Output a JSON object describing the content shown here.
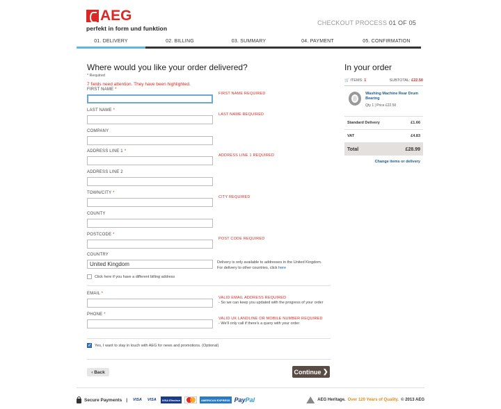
{
  "header": {
    "brand": "AEG",
    "tagline": "perfekt in form und funktion",
    "process_label": "CHECKOUT PROCESS",
    "process_current": "01 OF 05"
  },
  "steps": [
    {
      "label": "01. DELIVERY",
      "active": true
    },
    {
      "label": "02. BILLING",
      "active": false
    },
    {
      "label": "03. SUMMARY",
      "active": false
    },
    {
      "label": "04. PAYMENT",
      "active": false
    },
    {
      "label": "05. CONFIRMATION",
      "active": false
    }
  ],
  "form": {
    "title": "Where would you like your order delivered?",
    "required_note": "Required",
    "error_summary": "7 fields need attention. They have been highlighted.",
    "first_name": {
      "label": "FIRST NAME",
      "value": "",
      "error": "FIRST NAME REQUIRED"
    },
    "last_name": {
      "label": "LAST NAME",
      "value": "",
      "error": "LAST NAME REQUIRED"
    },
    "company": {
      "label": "COMPANY",
      "value": ""
    },
    "address1": {
      "label": "ADDRESS LINE 1",
      "value": "",
      "error": "ADDRESS LINE 1 REQUIRED"
    },
    "address2": {
      "label": "ADDRESS LINE 2",
      "value": ""
    },
    "town": {
      "label": "TOWN/CITY",
      "value": "",
      "error": "CITY REQUIRED"
    },
    "county": {
      "label": "COUNTY",
      "value": ""
    },
    "postcode": {
      "label": "POSTCODE",
      "value": "",
      "error": "POST CODE REQUIRED"
    },
    "country": {
      "label": "COUNTRY",
      "value": "United Kingdom",
      "note_1": "Delivery is only available to addresses in the United Kingdom.",
      "note_2": "For delivery to other countries, click ",
      "note_link": "here"
    },
    "billing_check": "Click here if you have a different billing address",
    "email": {
      "label": "EMAIL",
      "value": "",
      "error": "VALID EMAIL ADDRESS REQUIRED",
      "help": "- So we can keep you updated with the progress of your order"
    },
    "phone": {
      "label": "PHONE",
      "value": "",
      "error": "VALID UK LANDLINE OR MOBILE NUMBER REQUIRED",
      "help": "- We'll only call if there's a query with your order"
    },
    "newsletter": "Yes, I want to stay in touch with AEG for news and promotions. (Optional)",
    "back_label": "Back",
    "continue_label": "Continue"
  },
  "summary": {
    "title": "In your order",
    "items_label": "ITEMS:",
    "items_count": "1",
    "subtotal_label": "SUBTOTAL:",
    "subtotal_value": "£22.50",
    "item_name": "Washing Machine Rear Drum Bearing",
    "item_qty": "Qty 1  |  Price £22.50",
    "delivery_label": "Standard Delivery",
    "delivery_value": "£1.66",
    "vat_label": "VAT",
    "vat_value": "£4.83",
    "total_label": "Total",
    "total_value": "£28.99",
    "change_link": "Change items or delivery"
  },
  "footer": {
    "secure_label": "Secure Payments",
    "separator": "|",
    "cards": [
      "VISA",
      "VISA",
      "VISA Electron",
      "MasterCard",
      "AMERICAN EXPRESS"
    ],
    "paypal_pay": "Pay",
    "paypal_pal": "Pal",
    "heritage_1": "AEG Heritage.",
    "heritage_2": "Over 120 Years of Quality.",
    "heritage_3": "© 2013 AEG"
  }
}
